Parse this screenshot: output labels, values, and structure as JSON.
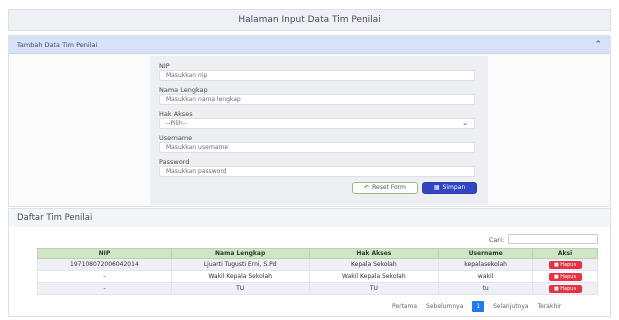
{
  "page": {
    "title": "Halaman Input Data Tim Penilai"
  },
  "form_card": {
    "title": "Tambah Data Tim Penilai",
    "fields": [
      {
        "label": "NIP",
        "placeholder": "Masukkan nip"
      },
      {
        "label": "Nama Lengkap",
        "placeholder": "Masukkan nama lengkap"
      },
      {
        "label": "Hak Akses",
        "placeholder": "--Pilih--"
      },
      {
        "label": "Username",
        "placeholder": "Masukkan username"
      },
      {
        "label": "Password",
        "placeholder": "Masukkan password"
      }
    ],
    "reset_label": "Reset Form",
    "save_label": "Simpan"
  },
  "list": {
    "title": "Daftar Tim Penilai",
    "search_label": "Cari:",
    "columns": [
      "NIP",
      "Nama Lengkap",
      "Hak Akses",
      "Username",
      "Aksi"
    ],
    "rows": [
      {
        "nip": "197108072006042014",
        "nama": "Ljuarti Tugusti Erni, S.Pd",
        "hak": "Kepala Sekolah",
        "username": "kepalasekolah",
        "aksi": "Hapus"
      },
      {
        "nip": "-",
        "nama": "Wakil Kepala Sekolah",
        "hak": "Wakil Kepala Sekolah",
        "username": "wakil",
        "aksi": "Hapus"
      },
      {
        "nip": "-",
        "nama": "TU",
        "hak": "TU",
        "username": "tu",
        "aksi": "Hapus"
      }
    ],
    "pagination": {
      "first": "Pertama",
      "prev": "Sebelumnya",
      "current": "1",
      "next": "Selanjutnya",
      "last": "Terakhir"
    }
  },
  "colors": {
    "header_blue": "#d5e2f8",
    "table_head_green": "#cfe6c4",
    "primary": "#3245c2",
    "danger": "#e53343",
    "page_active": "#1f7cf2"
  }
}
